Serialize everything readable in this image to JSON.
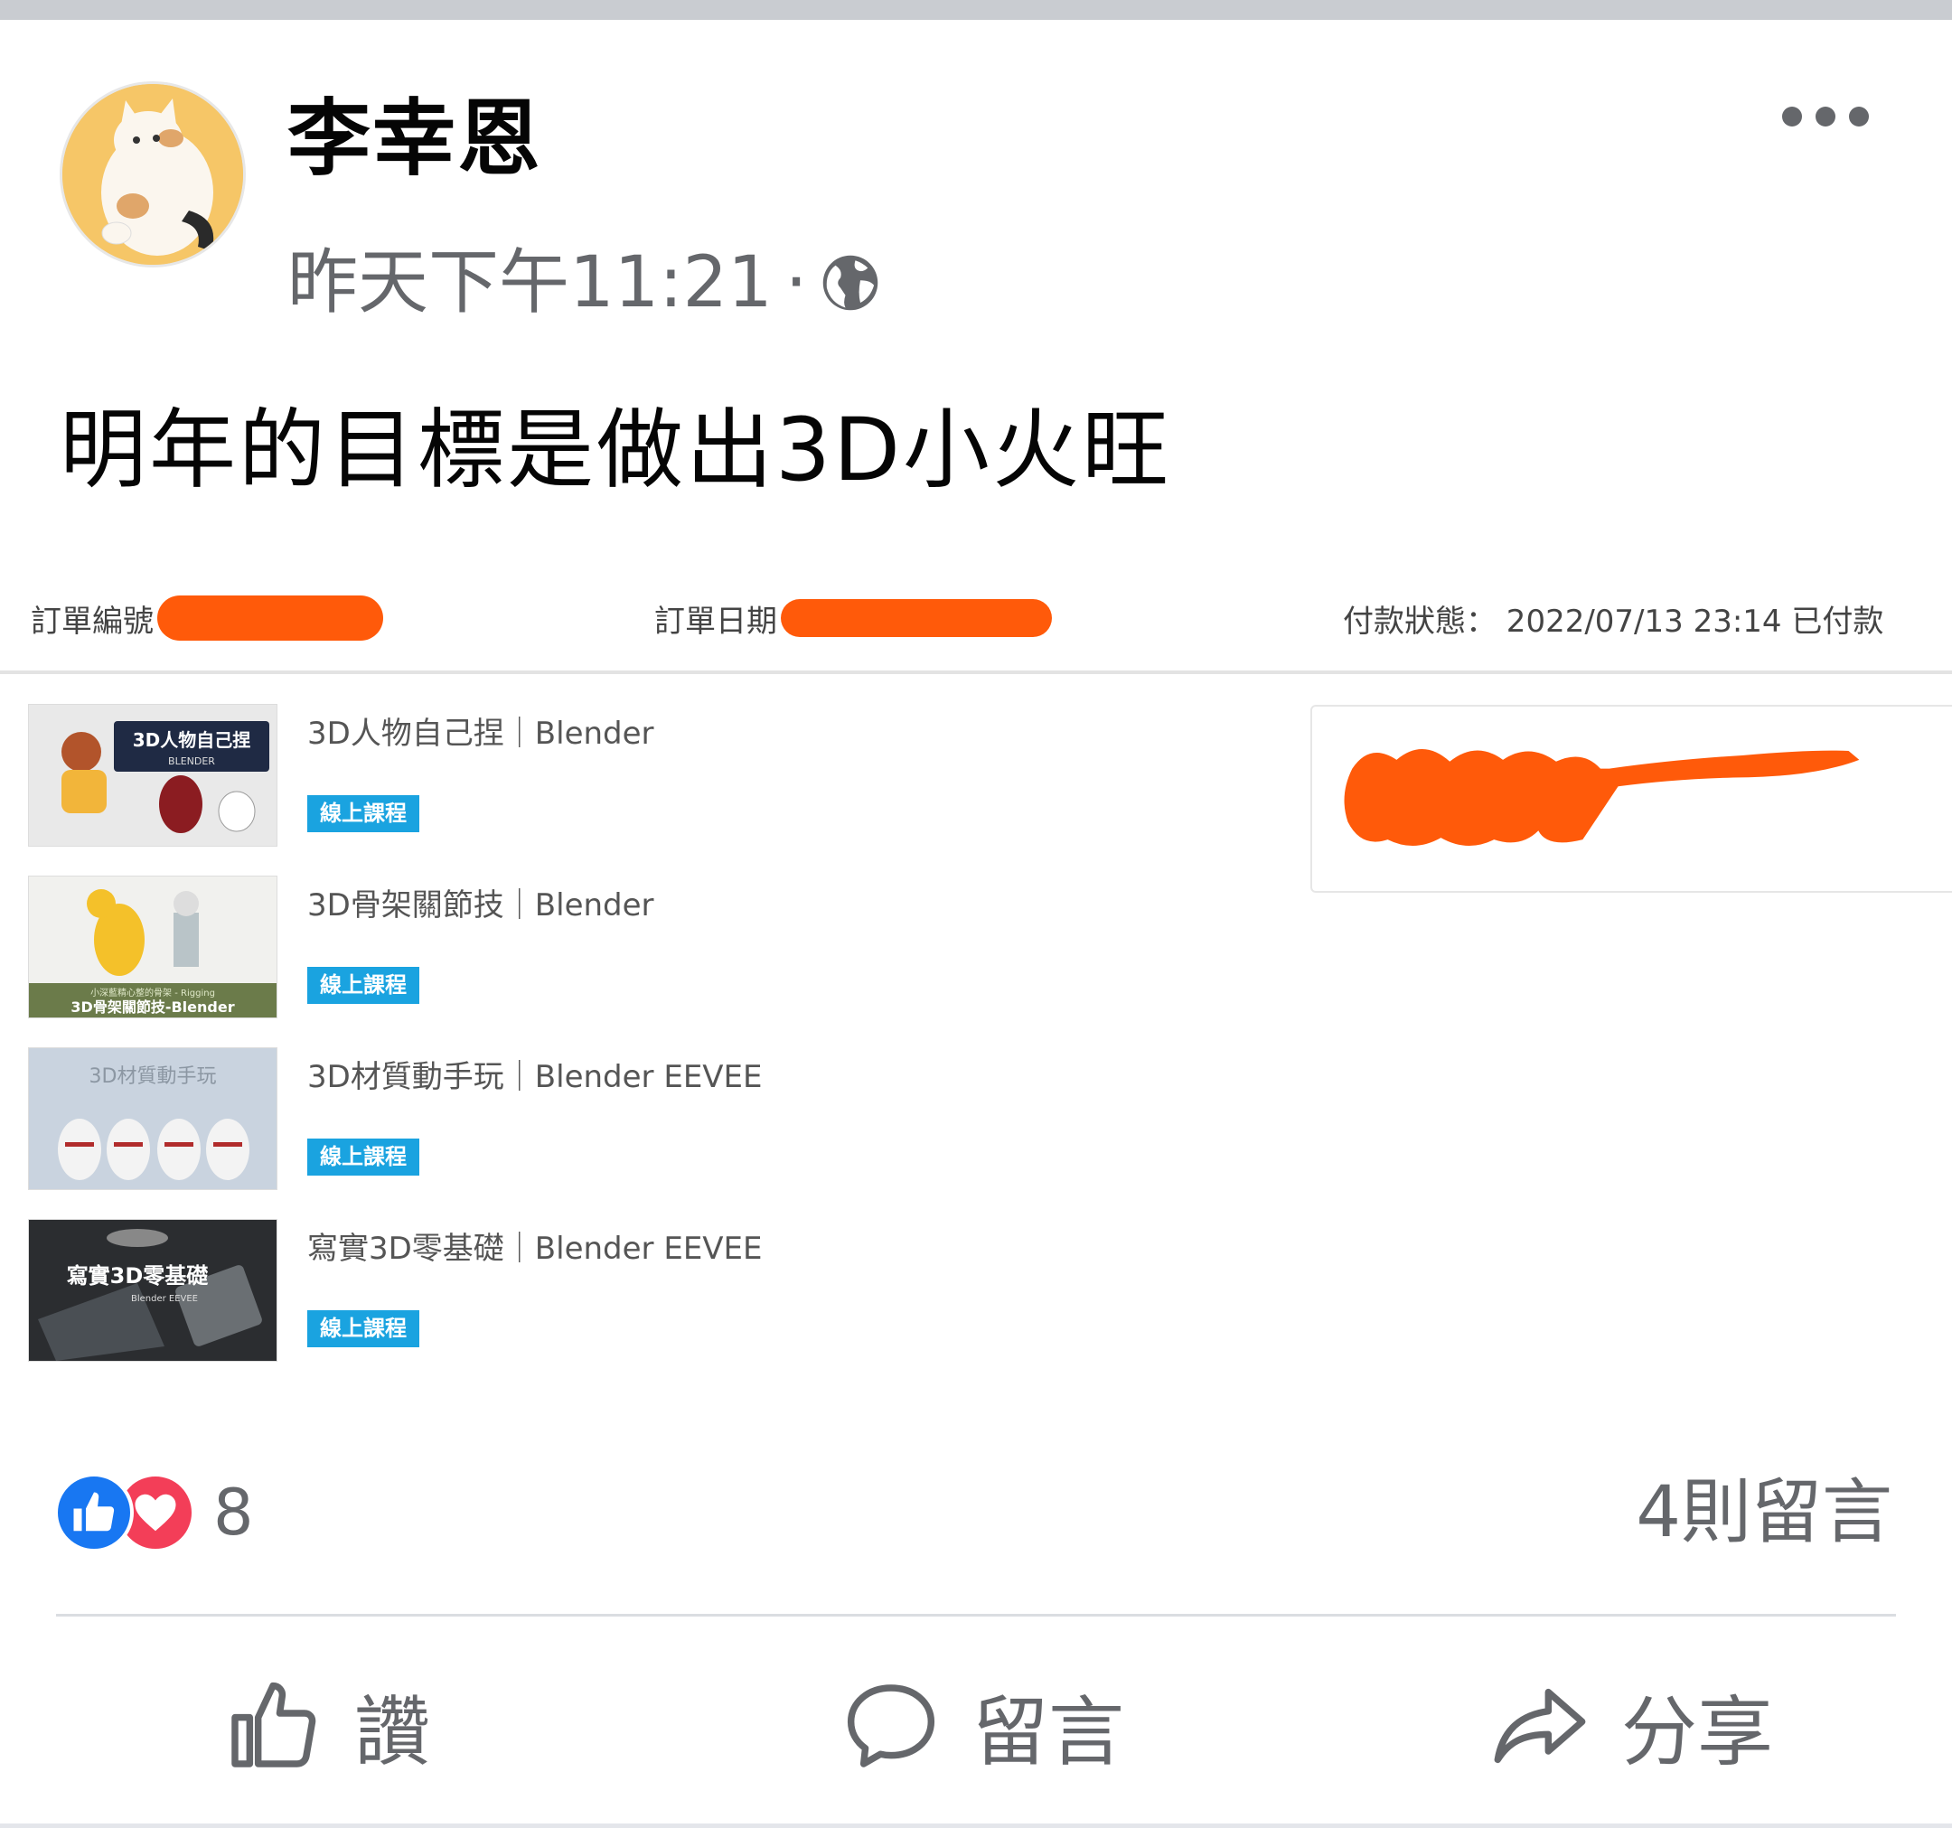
{
  "post": {
    "author": "李幸恩",
    "timestamp": "昨天下午11:21",
    "separator": "·",
    "privacy_icon": "globe-icon",
    "more_icon": "more-horizontal-icon",
    "text": "明年的目標是做出3D小火旺"
  },
  "order": {
    "order_number_label": "訂單編號",
    "order_date_label": "訂單日期",
    "payment_status": "付款狀態： 2022/07/13 23:14 已付款",
    "items": [
      {
        "title": "3D人物自己捏｜Blender",
        "tag": "線上課程",
        "thumb_text": "3D人物自己捏",
        "thumb_sub": "BLENDER"
      },
      {
        "title": "3D骨架關節技｜Blender",
        "tag": "線上課程",
        "thumb_text": "3D骨架關節技-Blender",
        "thumb_sub": "小深藍精心整的骨架 - Rigging"
      },
      {
        "title": "3D材質動手玩｜Blender EEVEE",
        "tag": "線上課程",
        "thumb_text": "3D材質動手玩",
        "thumb_sub": ""
      },
      {
        "title": "寫實3D零基礎｜Blender EEVEE",
        "tag": "線上課程",
        "thumb_text": "寫實3D零基礎",
        "thumb_sub": "Blender EEVEE"
      }
    ],
    "redaction_color": "#ff5a0a"
  },
  "reactions": {
    "icons": [
      "like-icon",
      "love-icon"
    ],
    "count": "8",
    "comments": "4則留言"
  },
  "actions": [
    {
      "label": "讚",
      "icon": "thumbs-up-icon"
    },
    {
      "label": "留言",
      "icon": "comment-icon"
    },
    {
      "label": "分享",
      "icon": "share-icon"
    }
  ],
  "colors": {
    "like_blue": "#1877f2",
    "love_red": "#f33e58",
    "secondary_text": "#65676b",
    "course_tag": "#1aa3e0"
  }
}
